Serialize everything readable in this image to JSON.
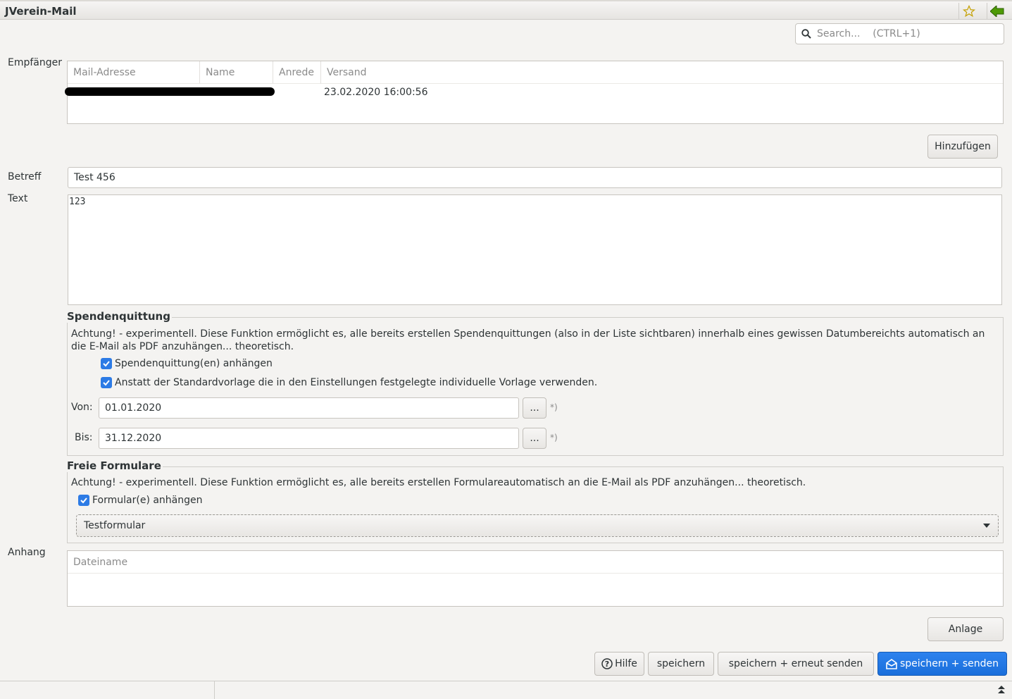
{
  "window": {
    "title": "JVerein-Mail"
  },
  "search": {
    "placeholder": "Search...    (CTRL+1)"
  },
  "recipients": {
    "label": "Empfänger",
    "columns": [
      "Mail-Adresse",
      "Name",
      "Anrede",
      "Versand"
    ],
    "rows": [
      {
        "versand": "23.02.2020 16:00:56"
      }
    ],
    "add_button": "Hinzufügen"
  },
  "subject": {
    "label": "Betreff",
    "value": "Test 456"
  },
  "text": {
    "label": "Text",
    "value": "123"
  },
  "donation": {
    "title": "Spendenquittung",
    "note": "Achtung! - experimentell. Diese Funktion ermöglicht es, alle bereits erstellen Spendenquittungen (also in der Liste sichtbaren) innerhalb eines gewissen Datumbereichts automatisch an die E-Mail als PDF anzuhängen... theoretisch.",
    "check1": "Spendenquittung(en) anhängen",
    "check2": "Anstatt der Standardvorlage die in den Einstellungen festgelegte individuelle Vorlage verwenden.",
    "from_label": "Von:",
    "from_value": "01.01.2020",
    "to_label": "Bis:",
    "to_value": "31.12.2020",
    "picker": "...",
    "required_mark": "*)"
  },
  "forms": {
    "title": "Freie Formulare",
    "note": "Achtung! - experimentell. Diese Funktion ermöglicht es, alle bereits erstellen Formulareautomatisch an die E-Mail als PDF anzuhängen... theoretisch.",
    "check": "Formular(e) anhängen",
    "selected": "Testformular"
  },
  "attachment": {
    "label": "Anhang",
    "column": "Dateiname",
    "button": "Anlage"
  },
  "actions": {
    "help": "Hilfe",
    "save": "speichern",
    "save_resend": "speichern + erneut senden",
    "save_send": "speichern + senden"
  },
  "colors": {
    "accent": "#2d7be5",
    "primary_button": "#1a6fdb"
  }
}
